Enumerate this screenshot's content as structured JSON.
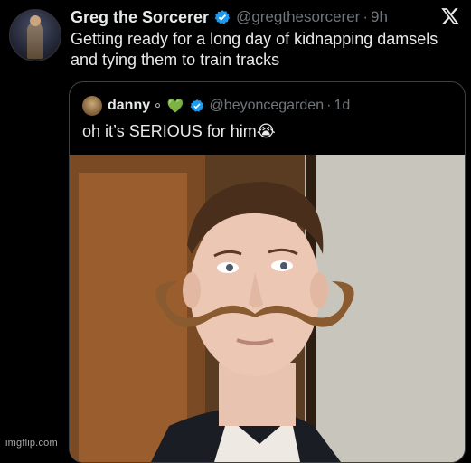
{
  "tweet": {
    "author_name": "Greg the Sorcerer",
    "handle": "@gregthesorcerer",
    "separator": "·",
    "time": "9h",
    "text": "Getting ready for a long day of kidnapping damsels and tying them to train tracks",
    "avatar_icon": "sorcerer-avatar",
    "verified_icon": "verified-badge-icon",
    "platform_icon": "x-logo-icon"
  },
  "quoted_tweet": {
    "author_name": "danny",
    "emojis": "⚬ 💚",
    "handle": "@beyoncegarden",
    "separator": "·",
    "time": "1d",
    "text": "oh it’s SERIOUS for him😭",
    "photo_description_icon": "mustache-man-photo"
  },
  "watermark": "imgflip.com",
  "colors": {
    "background": "#000000",
    "text_primary": "#e7e9ea",
    "text_secondary": "#71767b",
    "verified": "#1d9bf0",
    "border": "#3e4144"
  }
}
